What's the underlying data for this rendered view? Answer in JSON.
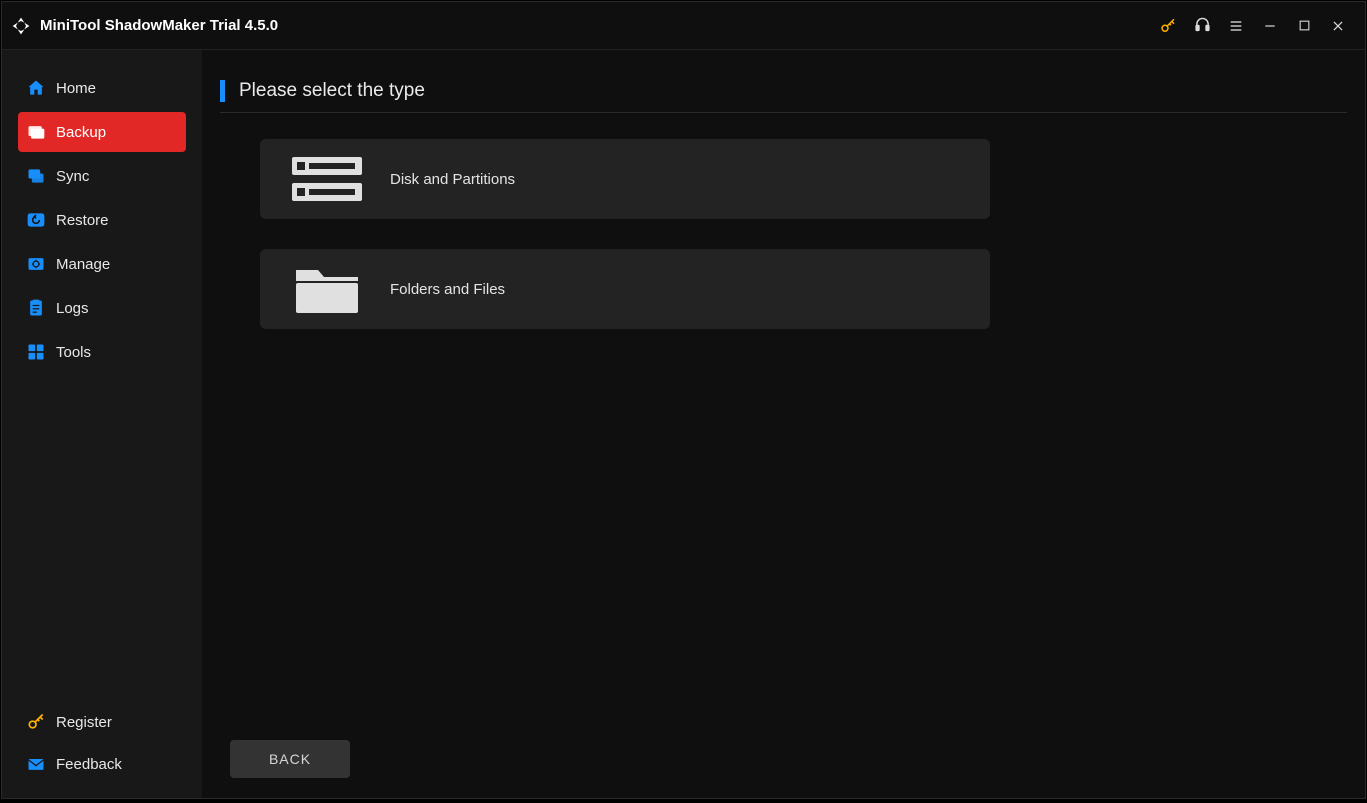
{
  "titlebar": {
    "app_title": "MiniTool ShadowMaker Trial 4.5.0"
  },
  "sidebar": {
    "items": [
      {
        "label": "Home",
        "icon": "home-icon",
        "active": false
      },
      {
        "label": "Backup",
        "icon": "backup-icon",
        "active": true
      },
      {
        "label": "Sync",
        "icon": "sync-icon",
        "active": false
      },
      {
        "label": "Restore",
        "icon": "restore-icon",
        "active": false
      },
      {
        "label": "Manage",
        "icon": "manage-icon",
        "active": false
      },
      {
        "label": "Logs",
        "icon": "logs-icon",
        "active": false
      },
      {
        "label": "Tools",
        "icon": "tools-icon",
        "active": false
      }
    ],
    "bottom_items": [
      {
        "label": "Register",
        "icon": "key-icon"
      },
      {
        "label": "Feedback",
        "icon": "mail-icon"
      }
    ]
  },
  "main": {
    "header": "Please select the type",
    "options": [
      {
        "label": "Disk and Partitions",
        "icon": "disk-icon"
      },
      {
        "label": "Folders and Files",
        "icon": "folder-icon"
      }
    ],
    "back_label": "BACK"
  },
  "colors": {
    "accent_red": "#e22827",
    "accent_blue": "#188efb",
    "register_yellow": "#ffb300"
  }
}
